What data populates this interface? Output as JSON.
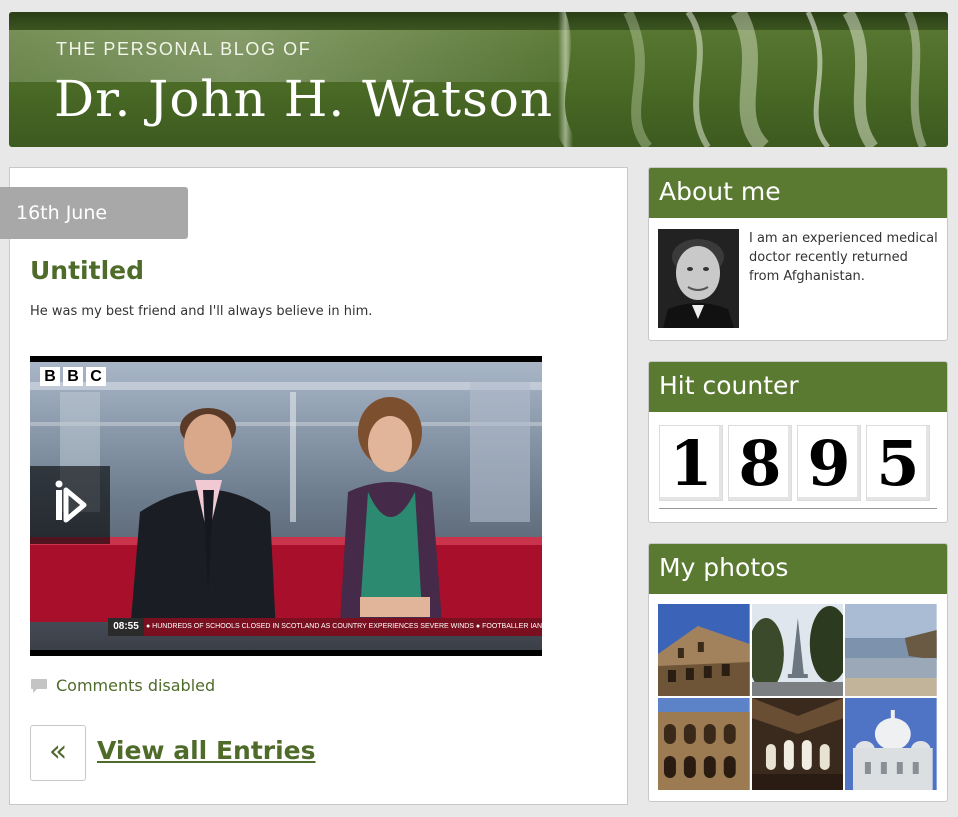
{
  "banner": {
    "subtitle": "THE PERSONAL BLOG OF",
    "title": "Dr. John H. Watson"
  },
  "post": {
    "date": "16th June",
    "title": "Untitled",
    "body": "He was my best friend and I'll always believe in him.",
    "video": {
      "logo_letters": [
        "B",
        "B",
        "C"
      ],
      "ticker_time": "08:55",
      "ticker_text": "● HUNDREDS OF SCHOOLS CLOSED IN SCOTLAND AS COUNTRY EXPERIENCES SEVERE WINDS  ● FOOTBALLER IAN FA"
    },
    "comments_label": "Comments disabled",
    "prev_symbol": "«",
    "view_all_label": "View all Entries"
  },
  "sidebar": {
    "about": {
      "heading": "About me",
      "bio": "I am an experienced medical doctor recently returned from Afghanistan."
    },
    "counter": {
      "heading": "Hit counter",
      "digits": [
        "1",
        "8",
        "9",
        "5"
      ]
    },
    "photos": {
      "heading": "My photos",
      "thumbnails": [
        "colosseum-exterior",
        "eiffel-tower-trees",
        "coastal-cliffs",
        "colosseum-arches",
        "cathedral-interior",
        "sacre-coeur"
      ]
    }
  },
  "colors": {
    "accent": "#5a7a32",
    "link": "#4f6b2a",
    "date_tab": "#a8a8a8"
  }
}
